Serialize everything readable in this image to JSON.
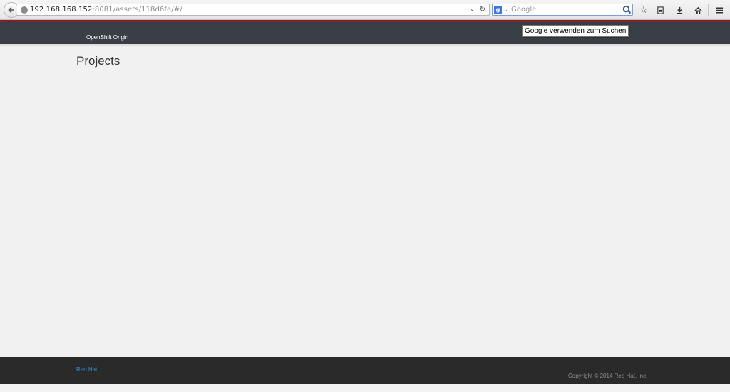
{
  "browser": {
    "url_host": "192.168.168.152",
    "url_rest": ":8081/assets/118d6fe/#/",
    "search_placeholder": "Google",
    "search_engine_letter": "g",
    "tooltip": "Google verwenden zum Suchen"
  },
  "navbar": {
    "brand": "OpenShift Origin",
    "accent_color": "#cc0000",
    "background": "#393f44"
  },
  "main": {
    "title": "Projects"
  },
  "footer": {
    "link": "Red Hat",
    "copyright": "Copyright © 2014 Red Hat, Inc."
  },
  "icons": [
    "back-arrow-icon",
    "globe-icon",
    "dropdown-icon",
    "reload-icon",
    "google-icon",
    "search-icon",
    "bookmark-star-icon",
    "reading-list-icon",
    "downloads-icon",
    "home-icon",
    "menu-icon"
  ]
}
